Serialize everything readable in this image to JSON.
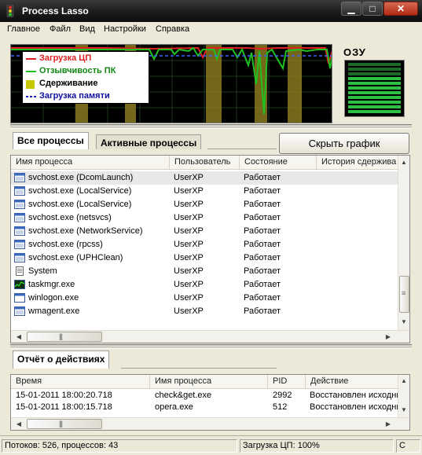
{
  "window": {
    "title": "Process Lasso"
  },
  "menu": [
    "Главное",
    "Файл",
    "Вид",
    "Настройки",
    "Справка"
  ],
  "graph": {
    "legend": [
      {
        "label": "Загрузка ЦП",
        "color": "#e02020"
      },
      {
        "label": "Отзывчивость ПК",
        "color": "#20c020"
      },
      {
        "label": "Сдерживание",
        "color": "#c8c800"
      },
      {
        "label": "Загрузка памяти",
        "color": "#2020c0"
      }
    ]
  },
  "ram": {
    "label": "ОЗУ"
  },
  "tabs": {
    "all": "Все процессы",
    "active": "Активные процессы"
  },
  "hide_graph_button": "Скрыть график",
  "process_table": {
    "columns": [
      "Имя процесса",
      "Пользователь",
      "Состояние",
      "История сдержива"
    ],
    "rows": [
      {
        "name": "svchost.exe (DcomLaunch)",
        "user": "UserXP",
        "state": "Работает",
        "icon": "window-icon"
      },
      {
        "name": "svchost.exe (LocalService)",
        "user": "UserXP",
        "state": "Работает",
        "icon": "window-icon"
      },
      {
        "name": "svchost.exe (LocalService)",
        "user": "UserXP",
        "state": "Работает",
        "icon": "window-icon"
      },
      {
        "name": "svchost.exe (netsvcs)",
        "user": "UserXP",
        "state": "Работает",
        "icon": "window-icon"
      },
      {
        "name": "svchost.exe (NetworkService)",
        "user": "UserXP",
        "state": "Работает",
        "icon": "window-icon"
      },
      {
        "name": "svchost.exe (rpcss)",
        "user": "UserXP",
        "state": "Работает",
        "icon": "window-icon"
      },
      {
        "name": "svchost.exe (UPHClean)",
        "user": "UserXP",
        "state": "Работает",
        "icon": "window-icon"
      },
      {
        "name": "System",
        "user": "UserXP",
        "state": "Работает",
        "icon": "document-icon"
      },
      {
        "name": "taskmgr.exe",
        "user": "UserXP",
        "state": "Работает",
        "icon": "taskmgr-icon"
      },
      {
        "name": "winlogon.exe",
        "user": "UserXP",
        "state": "Работает",
        "icon": "blank-window-icon"
      },
      {
        "name": "wmagent.exe",
        "user": "UserXP",
        "state": "Работает",
        "icon": "window-icon"
      }
    ]
  },
  "actions": {
    "tab": "Отчёт о действиях",
    "columns": [
      "Время",
      "Имя процесса",
      "PID",
      "Действие"
    ],
    "rows": [
      {
        "time": "15-01-2011 18:00:20.718",
        "process": "check&get.exe",
        "pid": "2992",
        "action": "Восстановлен исходный"
      },
      {
        "time": "15-01-2011 18:00:15.718",
        "process": "opera.exe",
        "pid": "512",
        "action": "Восстановлен исходный"
      }
    ]
  },
  "status": {
    "threads": "Потоков: 526,  процессов: 43",
    "cpu": "Загрузка ЦП: 100%",
    "extra": "С"
  }
}
